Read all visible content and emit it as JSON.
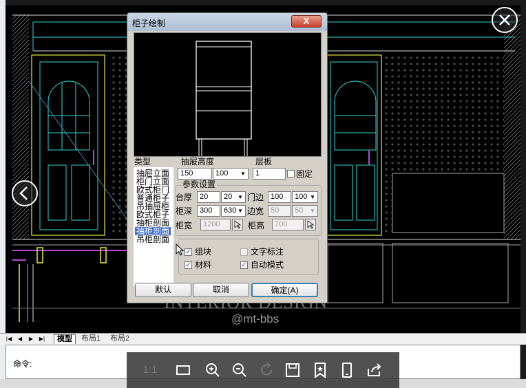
{
  "dialog": {
    "title": "柜子绘制",
    "close_label": "X",
    "type_label": "类型",
    "types": [
      "抽屉立面",
      "柜门立面",
      "欧式柜门",
      "普通柜子",
      "吊抽屉柜",
      "欧式柜子",
      "抽柜剖面",
      "抽柜剖面",
      "吊柜剖面"
    ],
    "selected_type_index": 7,
    "drawer_height": {
      "label": "抽屉高度",
      "value": "150",
      "combo": "100"
    },
    "shelf": {
      "label": "层板",
      "value": "1",
      "fixed_label": "固定",
      "fixed_checked": false
    },
    "params_label": "参数设置",
    "base_thickness": {
      "label": "台厚",
      "value": "20",
      "combo": "20"
    },
    "door_edge": {
      "label": "门边",
      "value": "100",
      "combo": "100"
    },
    "cabinet_depth": {
      "label": "柜深",
      "value": "300",
      "combo": "630"
    },
    "edge_width": {
      "label": "边宽",
      "value": "50",
      "combo": "50"
    },
    "cabinet_width": {
      "label": "柜宽",
      "value": "1200"
    },
    "cabinet_height": {
      "label": "柜高",
      "value": "700"
    },
    "options": {
      "group": {
        "label": "组块",
        "checked": true
      },
      "text_annot": {
        "label": "文字标注",
        "checked": false
      },
      "material": {
        "label": "材料",
        "checked": true
      },
      "auto_mode": {
        "label": "自动模式",
        "checked": true
      }
    },
    "buttons": {
      "default": "默认",
      "cancel": "取消",
      "ok": "确定(A)"
    }
  },
  "layout_tabs": [
    "模型",
    "布局1",
    "布局2"
  ],
  "command": {
    "prompt": "命令:"
  },
  "viewer": {
    "ratio_label": "1:1",
    "watermark": "INTERIOR DESIGN",
    "watermark_sub": "@mt-bbs"
  },
  "colors": {
    "cad_bg": "#000000",
    "cad_yellow": "#e8e84a",
    "cad_cyan": "#2fd6d6",
    "cad_purple": "#b04ad6",
    "selection": "#3d6fd4"
  }
}
